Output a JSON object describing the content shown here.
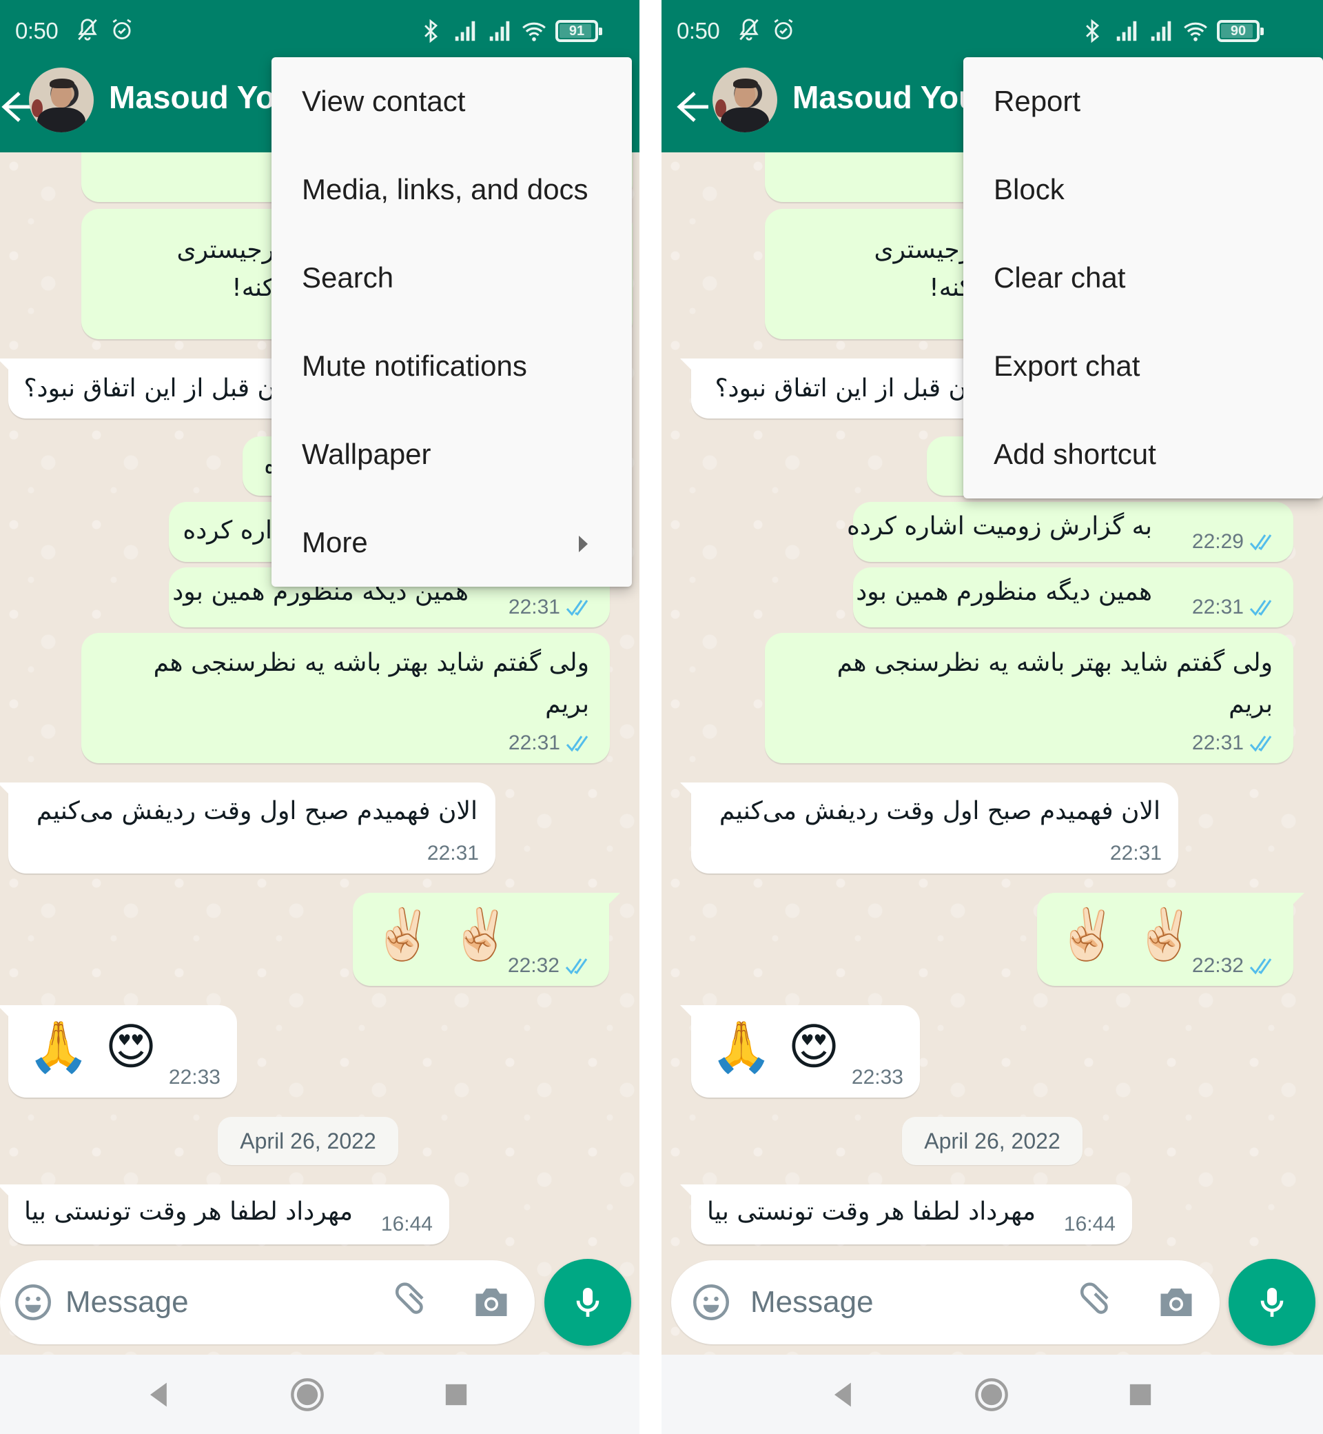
{
  "colors": {
    "header": "#008069",
    "chat_background": "#efe7dd",
    "outgoing_bubble": "#e7ffdb",
    "incoming_bubble": "#ffffff",
    "read_ticks": "#53bdeb",
    "mic_button": "#00a884",
    "menu_background": "#f9f9f9"
  },
  "left_screen": {
    "status_bar": {
      "time": "0:50",
      "battery": "91",
      "icons": [
        "muted-bell-icon",
        "alarm-icon",
        "bluetooth-icon",
        "signal-icon",
        "signal-icon",
        "wifi-icon",
        "battery-icon"
      ]
    },
    "header": {
      "contact_name": "Masoud Yo",
      "back_icon": "arrow-left-icon",
      "avatar": "contact-avatar"
    },
    "menu": {
      "items": [
        {
          "label": "View contact"
        },
        {
          "label": "Media, links, and docs"
        },
        {
          "label": "Search"
        },
        {
          "label": "Mute notifications"
        },
        {
          "label": "Wallpaper"
        },
        {
          "label": "More",
          "has_submenu": true
        }
      ]
    }
  },
  "right_screen": {
    "status_bar": {
      "time": "0:50",
      "battery": "90",
      "icons": [
        "muted-bell-icon",
        "alarm-icon",
        "bluetooth-icon",
        "signal-icon",
        "signal-icon",
        "wifi-icon",
        "battery-icon"
      ]
    },
    "header": {
      "contact_name": "Masoud You",
      "back_icon": "arrow-left-icon",
      "avatar": "contact-avatar"
    },
    "menu": {
      "items": [
        {
          "label": "Report"
        },
        {
          "label": "Block"
        },
        {
          "label": "Clear chat"
        },
        {
          "label": "Export chat"
        },
        {
          "label": "Add shortcut"
        }
      ]
    }
  },
  "messages": [
    {
      "direction": "out",
      "text": "",
      "time": "",
      "note": "cut off at top"
    },
    {
      "direction": "out",
      "text_line1": "رجیستری",
      "text_line2": "کنه!",
      "time": ""
    },
    {
      "direction": "in",
      "text": "ن قبل از این اتفاق نبود؟",
      "time": ""
    },
    {
      "direction": "out",
      "text": "ه",
      "time": ""
    },
    {
      "direction": "out",
      "text": "به گزارش زومیت اشاره کرده",
      "time": "22:29",
      "status": "read"
    },
    {
      "direction": "out",
      "text": "همین دیگه منظورم همین بود",
      "time": "22:31",
      "status": "read"
    },
    {
      "direction": "out",
      "text_line1": "ولی گفتم شاید بهتر باشه یه نظرسنجی هم",
      "text_line2": "بریم",
      "time": "22:31",
      "status": "read"
    },
    {
      "direction": "in",
      "text": "الان فهمیدم صبح اول وقت ردیفش می‌کنیم",
      "time": "22:31"
    },
    {
      "direction": "out",
      "emoji": "✌🏻 ✌🏻",
      "time": "22:32",
      "status": "read"
    },
    {
      "direction": "in",
      "emoji": "🙏 😍",
      "time": "22:33"
    },
    {
      "direction": "in",
      "text": "مهرداد لطفا هر وقت تونستی بیا",
      "time": "16:44"
    }
  ],
  "left_partial": {
    "m3_text": "ن قبل از این اتفاق نبود؟",
    "m5_text": "اره کرده",
    "m6_text": "همین دیگه منظورم همین بود"
  },
  "date_separator": "April 26, 2022",
  "composer": {
    "placeholder": "Message",
    "icons": [
      "emoji-icon",
      "paperclip-icon",
      "camera-icon",
      "microphone-icon"
    ]
  },
  "navbar": {
    "buttons": [
      "back",
      "home",
      "recents"
    ]
  }
}
